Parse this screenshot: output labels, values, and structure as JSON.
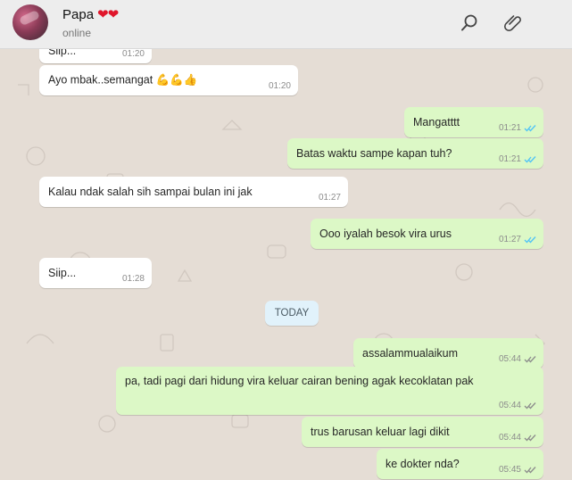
{
  "header": {
    "name": "Papa",
    "hearts": "❤❤",
    "status": "online"
  },
  "day_separator": "TODAY",
  "messages": [
    {
      "text": "Siip...",
      "time": "01:20",
      "dir": "in"
    },
    {
      "text": "Ayo mbak..semangat 💪💪👍",
      "time": "01:20",
      "dir": "in"
    },
    {
      "text": "Mangatttt",
      "time": "01:21",
      "dir": "out",
      "status": "read"
    },
    {
      "text": "Batas waktu sampe kapan tuh?",
      "time": "01:21",
      "dir": "out",
      "status": "read"
    },
    {
      "text": "Kalau ndak salah sih sampai bulan ini jak",
      "time": "01:27",
      "dir": "in"
    },
    {
      "text": "Ooo iyalah besok vira urus",
      "time": "01:27",
      "dir": "out",
      "status": "read"
    },
    {
      "text": "Siip...",
      "time": "01:28",
      "dir": "in"
    },
    {
      "text": "assalammualaikum",
      "time": "05:44",
      "dir": "out",
      "status": "delivered"
    },
    {
      "text": "pa, tadi pagi dari hidung vira keluar cairan bening agak kecoklatan pak",
      "time": "05:44",
      "dir": "out",
      "status": "delivered"
    },
    {
      "text": "trus barusan keluar lagi dikit",
      "time": "05:44",
      "dir": "out",
      "status": "delivered"
    },
    {
      "text": "ke dokter nda?",
      "time": "05:45",
      "dir": "out",
      "status": "delivered"
    }
  ],
  "colors": {
    "background": "#e5ddd5",
    "incoming": "#ffffff",
    "outgoing": "#dcf8c6",
    "read_tick": "#4fc3f7",
    "delivered_tick": "#8c8c8c",
    "header": "#ededed"
  },
  "icons": {
    "search": "search-icon",
    "attach": "paperclip-icon"
  }
}
